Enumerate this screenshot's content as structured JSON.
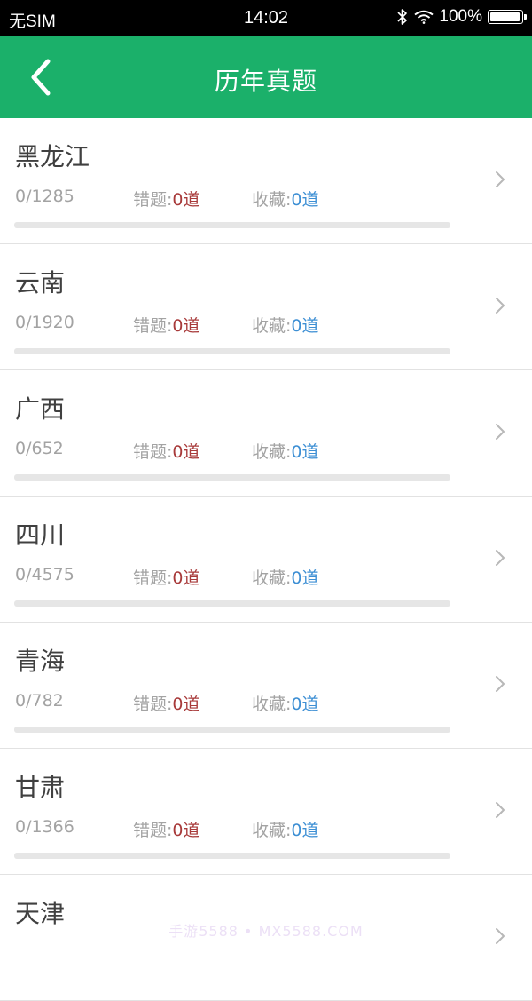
{
  "status_bar": {
    "carrier": "无SIM",
    "time": "14:02",
    "battery_text": "100%",
    "battery_level": 1.0
  },
  "header": {
    "title": "历年真题",
    "back_icon": "chevron-left-icon"
  },
  "labels": {
    "wrong_prefix": "错题:",
    "fav_prefix": "收藏:"
  },
  "colors": {
    "accent": "#1bb06a",
    "wrong": "#a83a3a",
    "fav": "#3d8fd4"
  },
  "items": [
    {
      "name": "黑龙江",
      "progress": "0/1285",
      "wrong": "0道",
      "fav": "0道"
    },
    {
      "name": "云南",
      "progress": "0/1920",
      "wrong": "0道",
      "fav": "0道"
    },
    {
      "name": "广西",
      "progress": "0/652",
      "wrong": "0道",
      "fav": "0道"
    },
    {
      "name": "四川",
      "progress": "0/4575",
      "wrong": "0道",
      "fav": "0道"
    },
    {
      "name": "青海",
      "progress": "0/782",
      "wrong": "0道",
      "fav": "0道"
    },
    {
      "name": "甘肃",
      "progress": "0/1366",
      "wrong": "0道",
      "fav": "0道"
    },
    {
      "name": "天津"
    }
  ],
  "watermark": "手游5588 • MX5588.COM"
}
